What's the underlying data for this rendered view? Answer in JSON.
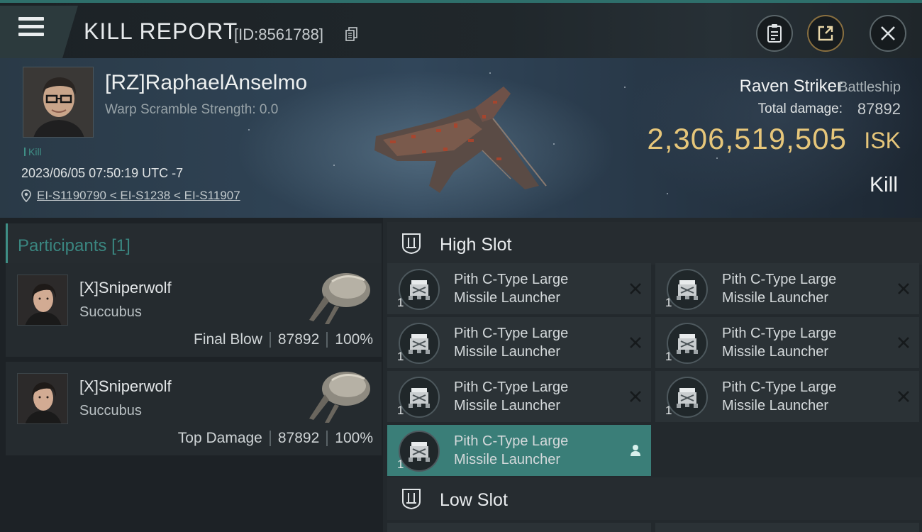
{
  "header": {
    "title": "KILL REPORT",
    "report_id": "[ID:8561788]"
  },
  "victim": {
    "name": "[RZ]RaphaelAnselmo",
    "warp_scramble": "Warp Scramble Strength: 0.0",
    "tag": "Kill",
    "datetime": "2023/06/05 07:50:19 UTC -7",
    "location": "EI-S1190790 < EI-S1238 < EI-S11907",
    "ship_name": "Raven Striker",
    "ship_class": "Battleship",
    "total_damage_label": "Total damage:",
    "total_damage": "87892",
    "isk_value": "2,306,519,505",
    "isk_unit": "ISK",
    "outcome": "Kill"
  },
  "participants": {
    "title": "Participants",
    "count": "[1]",
    "items": [
      {
        "name": "[X]Sniperwolf",
        "ship": "Succubus",
        "role": "Final Blow",
        "damage": "87892",
        "percent": "100%"
      },
      {
        "name": "[X]Sniperwolf",
        "ship": "Succubus",
        "role": "Top Damage",
        "damage": "87892",
        "percent": "100%"
      }
    ]
  },
  "fitting": {
    "high_slot_title": "High Slot",
    "low_slot_title": "Low Slot",
    "high_modules": [
      {
        "name_line1": "Pith C-Type Large",
        "name_line2": "Missile Launcher",
        "qty": "1",
        "status": "destroyed"
      },
      {
        "name_line1": "Pith C-Type Large",
        "name_line2": "Missile Launcher",
        "qty": "1",
        "status": "destroyed"
      },
      {
        "name_line1": "Pith C-Type Large",
        "name_line2": "Missile Launcher",
        "qty": "1",
        "status": "destroyed"
      },
      {
        "name_line1": "Pith C-Type Large",
        "name_line2": "Missile Launcher",
        "qty": "1",
        "status": "destroyed"
      },
      {
        "name_line1": "Pith C-Type Large",
        "name_line2": "Missile Launcher",
        "qty": "1",
        "status": "destroyed"
      },
      {
        "name_line1": "Pith C-Type Large",
        "name_line2": "Missile Launcher",
        "qty": "1",
        "status": "destroyed"
      },
      {
        "name_line1": "Pith C-Type Large",
        "name_line2": "Missile Launcher",
        "qty": "1",
        "status": "dropped"
      }
    ]
  },
  "colors": {
    "accent": "#3f8f86",
    "isk_gold": "#e6c67a",
    "active_module": "#3a7e78"
  }
}
